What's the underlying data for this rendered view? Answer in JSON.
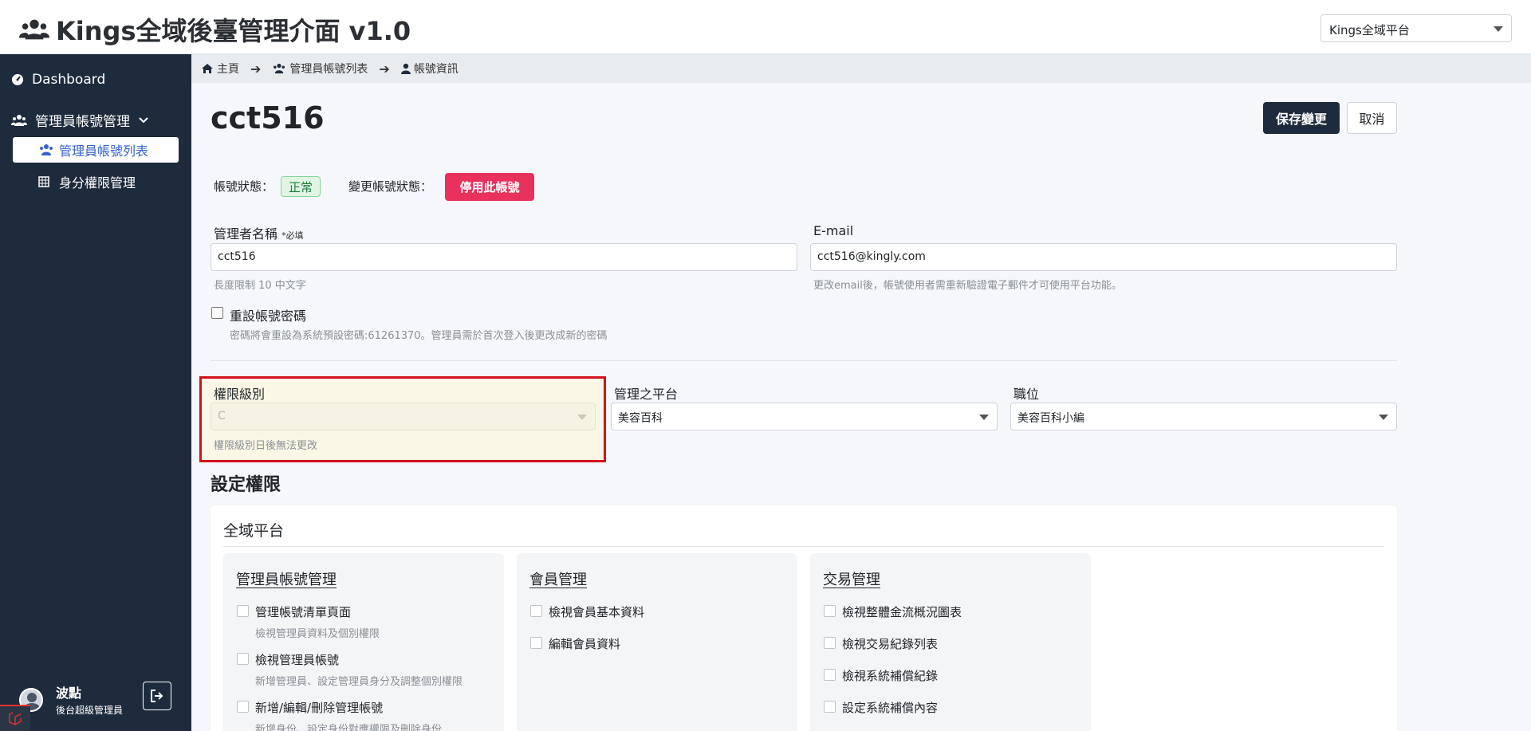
{
  "header": {
    "app_title": "Kings全域後臺管理介面 v1.0",
    "platform_selected": "Kings全域平台"
  },
  "sidebar": {
    "dashboard": "Dashboard",
    "admin_mgmt": "管理員帳號管理",
    "admin_list": "管理員帳號列表",
    "role_mgmt": "身分權限管理",
    "user_name": "波點",
    "user_role": "後台超級管理員"
  },
  "breadcrumb": {
    "home": "主頁",
    "list": "管理員帳號列表",
    "current": "帳號資訊"
  },
  "page": {
    "title": "cct516",
    "save_label": "保存變更",
    "cancel_label": "取消"
  },
  "status": {
    "label": "帳號狀態：",
    "value": "正常",
    "change_label": "變更帳號狀態：",
    "disable_button": "停用此帳號"
  },
  "form": {
    "name_label": "管理者名稱",
    "name_required": "*必填",
    "name_value": "cct516",
    "name_help": "長度限制 10 中文字",
    "email_label": "E-mail",
    "email_value": "cct516@kingly.com",
    "email_help": "更改email後，帳號使用者需重新驗證電子郵件才可使用平台功能。",
    "reset_label": "重設帳號密碼",
    "reset_help": "密碼將會重設為系統預設密碼:61261370。管理員需於首次登入後更改成新的密碼",
    "level_label": "權限級別",
    "level_value": "C",
    "level_help": "權限級別日後無法更改",
    "platform_label": "管理之平台",
    "platform_value": "美容百科",
    "position_label": "職位",
    "position_value": "美容百科小編"
  },
  "permissions": {
    "section_title": "設定權限",
    "card_title": "全域平台",
    "groups": [
      {
        "title": "管理員帳號管理",
        "items": [
          {
            "label": "管理帳號清單頁面",
            "desc": "檢視管理員資料及個別權限"
          },
          {
            "label": "檢視管理員帳號",
            "desc": "新增管理員、設定管理員身分及調整個別權限"
          },
          {
            "label": "新增/編輯/刪除管理帳號",
            "desc": "新增身份、設定身份對應權限及刪除身份"
          }
        ]
      },
      {
        "title": "會員管理",
        "items": [
          {
            "label": "檢視會員基本資料"
          },
          {
            "label": "編輯會員資料"
          }
        ]
      },
      {
        "title": "交易管理",
        "items": [
          {
            "label": "檢視整體金流概況圖表"
          },
          {
            "label": "檢視交易紀錄列表"
          },
          {
            "label": "檢視系統補償紀錄"
          },
          {
            "label": "設定系統補償內容"
          }
        ]
      }
    ]
  },
  "colors": {
    "sidebar_bg": "#1e2b3c",
    "danger": "#e8315d",
    "success": "#1b7a35",
    "highlight_border": "#d0101c"
  }
}
